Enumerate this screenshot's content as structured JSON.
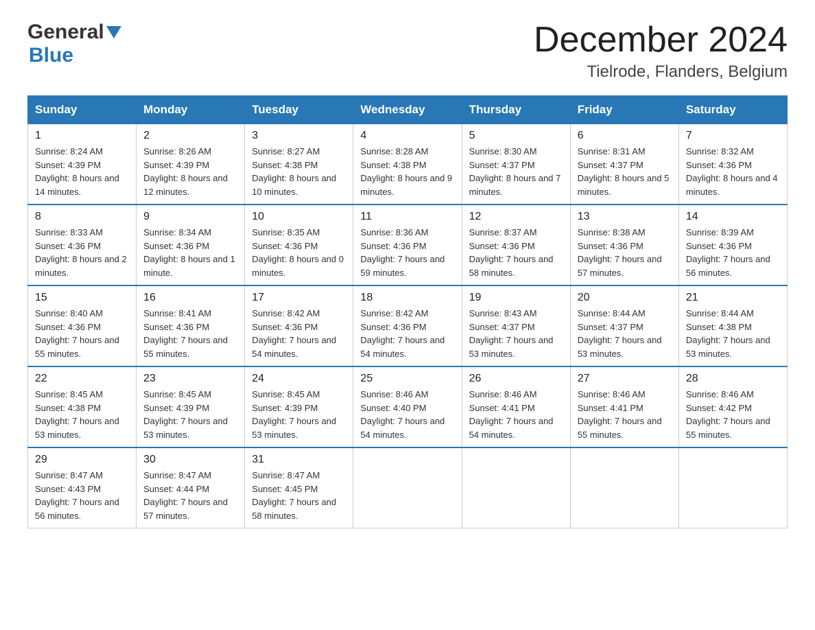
{
  "header": {
    "logo_general": "General",
    "logo_blue": "Blue",
    "month_title": "December 2024",
    "location": "Tielrode, Flanders, Belgium"
  },
  "days_of_week": [
    "Sunday",
    "Monday",
    "Tuesday",
    "Wednesday",
    "Thursday",
    "Friday",
    "Saturday"
  ],
  "weeks": [
    [
      {
        "num": "1",
        "sunrise": "8:24 AM",
        "sunset": "4:39 PM",
        "daylight": "8 hours and 14 minutes."
      },
      {
        "num": "2",
        "sunrise": "8:26 AM",
        "sunset": "4:39 PM",
        "daylight": "8 hours and 12 minutes."
      },
      {
        "num": "3",
        "sunrise": "8:27 AM",
        "sunset": "4:38 PM",
        "daylight": "8 hours and 10 minutes."
      },
      {
        "num": "4",
        "sunrise": "8:28 AM",
        "sunset": "4:38 PM",
        "daylight": "8 hours and 9 minutes."
      },
      {
        "num": "5",
        "sunrise": "8:30 AM",
        "sunset": "4:37 PM",
        "daylight": "8 hours and 7 minutes."
      },
      {
        "num": "6",
        "sunrise": "8:31 AM",
        "sunset": "4:37 PM",
        "daylight": "8 hours and 5 minutes."
      },
      {
        "num": "7",
        "sunrise": "8:32 AM",
        "sunset": "4:36 PM",
        "daylight": "8 hours and 4 minutes."
      }
    ],
    [
      {
        "num": "8",
        "sunrise": "8:33 AM",
        "sunset": "4:36 PM",
        "daylight": "8 hours and 2 minutes."
      },
      {
        "num": "9",
        "sunrise": "8:34 AM",
        "sunset": "4:36 PM",
        "daylight": "8 hours and 1 minute."
      },
      {
        "num": "10",
        "sunrise": "8:35 AM",
        "sunset": "4:36 PM",
        "daylight": "8 hours and 0 minutes."
      },
      {
        "num": "11",
        "sunrise": "8:36 AM",
        "sunset": "4:36 PM",
        "daylight": "7 hours and 59 minutes."
      },
      {
        "num": "12",
        "sunrise": "8:37 AM",
        "sunset": "4:36 PM",
        "daylight": "7 hours and 58 minutes."
      },
      {
        "num": "13",
        "sunrise": "8:38 AM",
        "sunset": "4:36 PM",
        "daylight": "7 hours and 57 minutes."
      },
      {
        "num": "14",
        "sunrise": "8:39 AM",
        "sunset": "4:36 PM",
        "daylight": "7 hours and 56 minutes."
      }
    ],
    [
      {
        "num": "15",
        "sunrise": "8:40 AM",
        "sunset": "4:36 PM",
        "daylight": "7 hours and 55 minutes."
      },
      {
        "num": "16",
        "sunrise": "8:41 AM",
        "sunset": "4:36 PM",
        "daylight": "7 hours and 55 minutes."
      },
      {
        "num": "17",
        "sunrise": "8:42 AM",
        "sunset": "4:36 PM",
        "daylight": "7 hours and 54 minutes."
      },
      {
        "num": "18",
        "sunrise": "8:42 AM",
        "sunset": "4:36 PM",
        "daylight": "7 hours and 54 minutes."
      },
      {
        "num": "19",
        "sunrise": "8:43 AM",
        "sunset": "4:37 PM",
        "daylight": "7 hours and 53 minutes."
      },
      {
        "num": "20",
        "sunrise": "8:44 AM",
        "sunset": "4:37 PM",
        "daylight": "7 hours and 53 minutes."
      },
      {
        "num": "21",
        "sunrise": "8:44 AM",
        "sunset": "4:38 PM",
        "daylight": "7 hours and 53 minutes."
      }
    ],
    [
      {
        "num": "22",
        "sunrise": "8:45 AM",
        "sunset": "4:38 PM",
        "daylight": "7 hours and 53 minutes."
      },
      {
        "num": "23",
        "sunrise": "8:45 AM",
        "sunset": "4:39 PM",
        "daylight": "7 hours and 53 minutes."
      },
      {
        "num": "24",
        "sunrise": "8:45 AM",
        "sunset": "4:39 PM",
        "daylight": "7 hours and 53 minutes."
      },
      {
        "num": "25",
        "sunrise": "8:46 AM",
        "sunset": "4:40 PM",
        "daylight": "7 hours and 54 minutes."
      },
      {
        "num": "26",
        "sunrise": "8:46 AM",
        "sunset": "4:41 PM",
        "daylight": "7 hours and 54 minutes."
      },
      {
        "num": "27",
        "sunrise": "8:46 AM",
        "sunset": "4:41 PM",
        "daylight": "7 hours and 55 minutes."
      },
      {
        "num": "28",
        "sunrise": "8:46 AM",
        "sunset": "4:42 PM",
        "daylight": "7 hours and 55 minutes."
      }
    ],
    [
      {
        "num": "29",
        "sunrise": "8:47 AM",
        "sunset": "4:43 PM",
        "daylight": "7 hours and 56 minutes."
      },
      {
        "num": "30",
        "sunrise": "8:47 AM",
        "sunset": "4:44 PM",
        "daylight": "7 hours and 57 minutes."
      },
      {
        "num": "31",
        "sunrise": "8:47 AM",
        "sunset": "4:45 PM",
        "daylight": "7 hours and 58 minutes."
      },
      null,
      null,
      null,
      null
    ]
  ],
  "labels": {
    "sunrise": "Sunrise:",
    "sunset": "Sunset:",
    "daylight": "Daylight:"
  }
}
